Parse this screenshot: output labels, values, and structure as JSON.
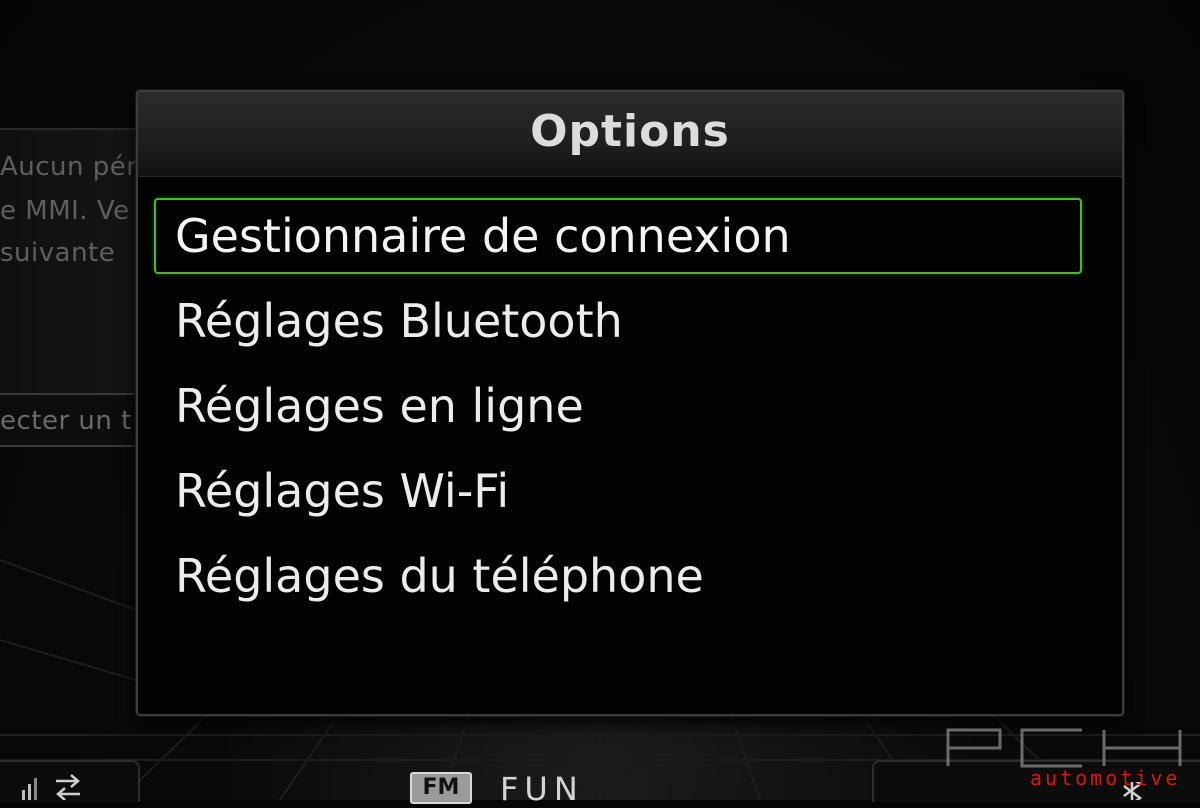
{
  "background_app": {
    "line1": "Aucun pér",
    "line2": "e MMI. Ve",
    "line3": "suivante",
    "action_label": "ecter un t"
  },
  "dialog": {
    "title": "Options",
    "items": [
      {
        "label": "Gestionnaire de connexion",
        "selected": true
      },
      {
        "label": "Réglages Bluetooth",
        "selected": false
      },
      {
        "label": "Réglages en ligne",
        "selected": false
      },
      {
        "label": "Réglages Wi-Fi",
        "selected": false
      },
      {
        "label": "Réglages du téléphone",
        "selected": false
      }
    ]
  },
  "status_bar": {
    "band": "FM",
    "station": "FUN",
    "icons": [
      "signal-icon",
      "swap-icon",
      "bluetooth-icon"
    ]
  },
  "watermark": {
    "logo": "PCH",
    "sub": "automotive"
  },
  "colors": {
    "selection": "#4fb52a",
    "text": "#ececec",
    "watermark_red": "#d01818"
  }
}
